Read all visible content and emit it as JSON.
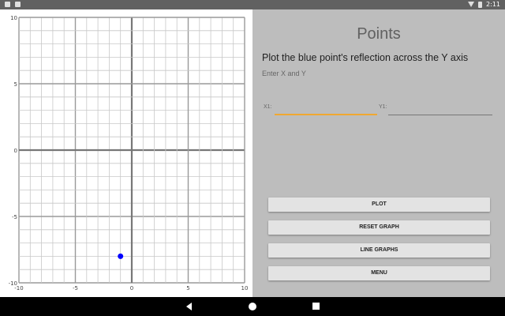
{
  "graph": {
    "x_ticks": [
      "-10",
      "-5",
      "0",
      "5",
      "10"
    ],
    "y_ticks": [
      "10",
      "5",
      "0",
      "-5",
      "-10"
    ],
    "point": {
      "x": -1,
      "y": -8,
      "color": "#0000ff"
    },
    "point_label": "blue point"
  },
  "panel": {
    "title": "Points",
    "prompt": "Plot the blue point's reflection across the Y axis",
    "hint": "Enter X and Y",
    "x_label": "X1:",
    "y_label": "Y1:",
    "x_value": "",
    "y_value": ""
  },
  "buttons": {
    "plot": "PLOT",
    "reset": "RESET GRAPH",
    "line_graphs": "LINE GRAPHS",
    "menu": "MENU"
  },
  "status": {
    "time": "2:11"
  },
  "colors": {
    "accent": "#f0a830",
    "point": "#0000ff"
  }
}
